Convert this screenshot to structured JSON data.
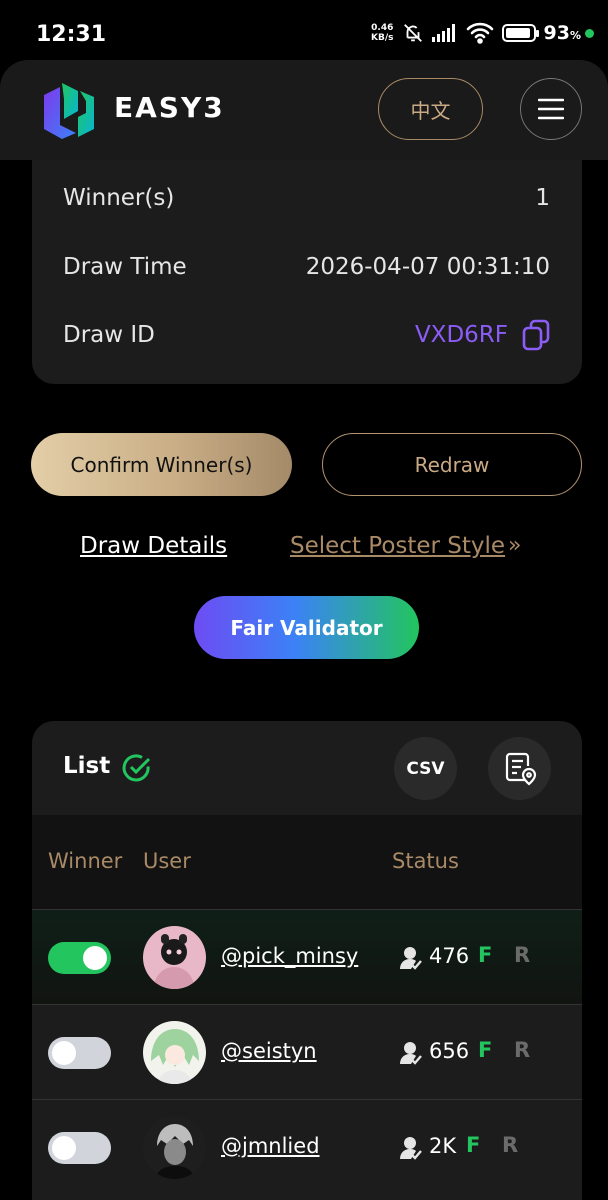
{
  "status_bar": {
    "time": "12:31",
    "speed_value": "0.46",
    "speed_unit": "KB/s",
    "battery": "93",
    "battery_unit": "%",
    "battery_level": 0.93
  },
  "header": {
    "brand": "EASY3",
    "lang_label": "中文",
    "menu_icon": "hamburger-icon"
  },
  "draw_info": {
    "winners_label": "Winner(s)",
    "winners_value": "1",
    "draw_time_label": "Draw Time",
    "draw_time_value": "2026-04-07 00:31:10",
    "draw_id_label": "Draw ID",
    "draw_id_value": "VXD6RF"
  },
  "actions": {
    "confirm_label": "Confirm Winner(s)",
    "redraw_label": "Redraw",
    "draw_details_label": "Draw Details",
    "poster_style_label": "Select Poster Style",
    "poster_arrow": "»",
    "fair_validator_label": "Fair Validator"
  },
  "list": {
    "title": "List",
    "csv_label": "CSV",
    "columns": {
      "winner": "Winner",
      "user": "User",
      "status": "Status"
    },
    "rows": [
      {
        "winner": true,
        "username": "@pick_minsy",
        "followers": "476",
        "f": "F",
        "r": "R"
      },
      {
        "winner": false,
        "username": "@seistyn",
        "followers": "656",
        "f": "F",
        "r": "R"
      },
      {
        "winner": false,
        "username": "@jmnlied",
        "followers": "2K",
        "f": "F",
        "r": "R"
      }
    ]
  },
  "colors": {
    "accent_gold": "#c9aa85",
    "accent_purple": "#8b5cf6",
    "accent_green": "#22c55e",
    "card_bg": "#1c1c1c"
  }
}
